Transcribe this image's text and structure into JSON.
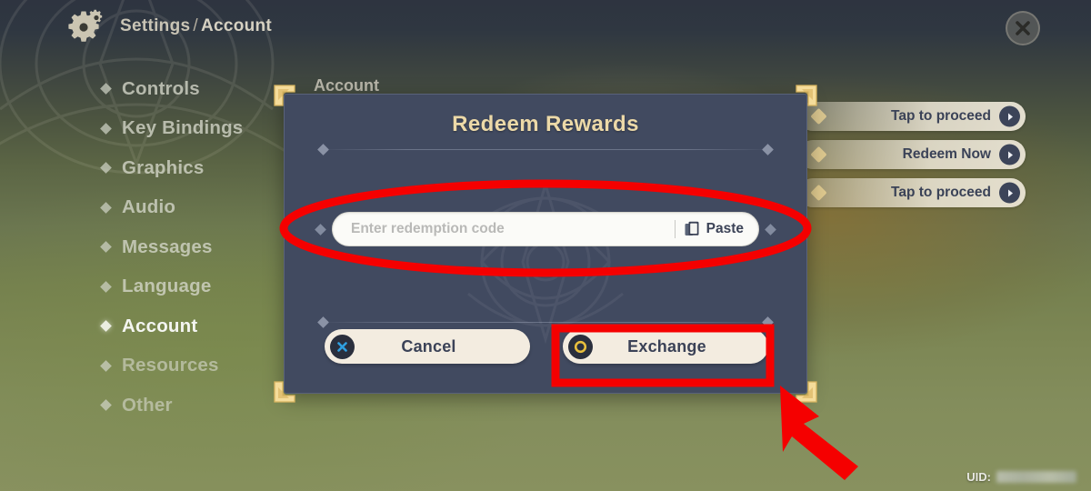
{
  "topbar": {
    "gear_icon": "gear-icon",
    "breadcrumb": {
      "root": "Settings",
      "separator": "/",
      "current": "Account"
    },
    "close_icon": "close-x-icon"
  },
  "sidebar": {
    "items": [
      {
        "label": "Controls",
        "active": false
      },
      {
        "label": "Key Bindings",
        "active": false
      },
      {
        "label": "Graphics",
        "active": false
      },
      {
        "label": "Audio",
        "active": false
      },
      {
        "label": "Messages",
        "active": false
      },
      {
        "label": "Language",
        "active": false
      },
      {
        "label": "Account",
        "active": true
      },
      {
        "label": "Resources",
        "active": false
      },
      {
        "label": "Other",
        "active": false
      }
    ]
  },
  "section": {
    "label": "Account"
  },
  "right_stack": {
    "buttons": [
      {
        "label": "Tap to proceed",
        "arrow_icon": "chevron-right-circle-icon"
      },
      {
        "label": "Redeem Now",
        "arrow_icon": "chevron-right-circle-icon"
      },
      {
        "label": "Tap to proceed",
        "arrow_icon": "chevron-right-circle-icon"
      }
    ]
  },
  "dialog": {
    "title": "Redeem Rewards",
    "input": {
      "placeholder": "Enter redemption code",
      "value": ""
    },
    "paste": {
      "label": "Paste",
      "icon": "clipboard-paste-icon"
    },
    "actions": {
      "cancel": {
        "label": "Cancel",
        "icon": "close-x-circle-icon"
      },
      "exchange": {
        "label": "Exchange",
        "icon": "gold-ring-icon"
      }
    }
  },
  "footer": {
    "uid_label": "UID:",
    "uid_value_redacted": true
  },
  "annotations": {
    "ellipse_target": "redemption-code-input",
    "box_target": "exchange-button",
    "arrow_target": "exchange-button",
    "color": "#f50000"
  },
  "colors": {
    "dialog_bg": "#414a60",
    "dialog_title": "#ecd9a8",
    "corner_gold": "#f4d98a",
    "button_cream": "#f3ece0",
    "button_text": "#3b4257",
    "annotation_red": "#f50000",
    "accent_blue": "#2f9fe0",
    "accent_gold": "#e8bf3d"
  }
}
